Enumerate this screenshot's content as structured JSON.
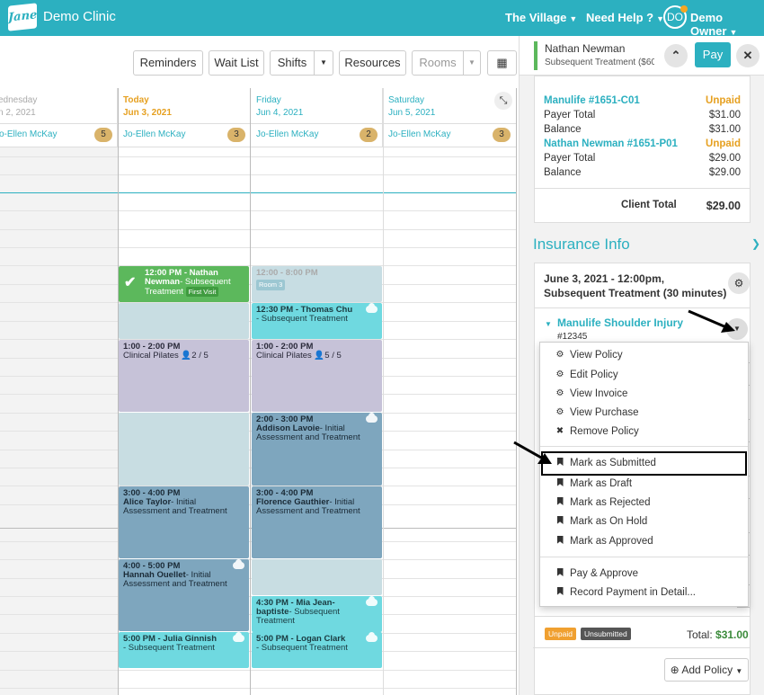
{
  "topbar": {
    "logo_text": "Jane",
    "clinic_name": "Demo Clinic",
    "location": "The Village",
    "help": "Need Help ?",
    "avatar_initials": "DO",
    "user": "Demo Owner"
  },
  "toolbar": {
    "reminders": "Reminders",
    "wait_list": "Wait List",
    "shifts": "Shifts",
    "resources": "Resources",
    "rooms": "Rooms"
  },
  "calendar": {
    "columns": [
      {
        "day": "ednesday",
        "date": "n 2, 2021",
        "staff": "o-Ellen McKay",
        "count": "5"
      },
      {
        "day": "Today",
        "date": "Jun 3, 2021",
        "staff": "Jo-Ellen McKay",
        "count": "3"
      },
      {
        "day": "Friday",
        "date": "Jun 4, 2021",
        "staff": "Jo-Ellen McKay",
        "count": "2"
      },
      {
        "day": "Saturday",
        "date": "Jun 5, 2021",
        "staff": "Jo-Ellen McKay",
        "count": "3"
      }
    ],
    "appointments": {
      "a1_time": "12:00 PM - Nathan",
      "a1_name": "Newman",
      "a1_desc": "- Subsequent",
      "a1_desc2": "Treatment",
      "a1_tag": "First Visit",
      "a2_time": "12:00 - 8:00 PM",
      "a2_room": "Room 3",
      "a3_time": "12:30 PM - Thomas Chu",
      "a3_desc": "- Subsequent Treatment",
      "a4_time": "1:00 - 2:00 PM",
      "a4_desc": "Clinical Pilates",
      "a4_count": "2 / 5",
      "a5_time": "1:00 - 2:00 PM",
      "a5_desc": "Clinical Pilates",
      "a5_count": "5 / 5",
      "a6_time": "2:00 - 3:00 PM",
      "a6_name": "Addison Lavoie",
      "a6_desc": "- Initial",
      "a6_desc2": "Assessment and Treatment",
      "a7_time": "3:00 - 4:00 PM",
      "a7_name": "Alice Taylor",
      "a7_desc": "- Initial",
      "a7_desc2": "Assessment and Treatment",
      "a8_time": "3:00 - 4:00 PM",
      "a8_name": "Florence Gauthier",
      "a8_desc": "- Initial",
      "a8_desc2": "Assessment and Treatment",
      "a9_time": "4:00 - 5:00 PM",
      "a9_name": "Hannah Ouellet",
      "a9_desc": "- Initial",
      "a9_desc2": "Assessment and Treatment",
      "a10_time": "4:30 PM - Mia Jean-",
      "a10_name": "baptiste",
      "a10_desc": "- Subsequent",
      "a10_desc2": "Treatment",
      "a11_time": "5:00 PM - Julia Ginnish",
      "a11_desc": "- Subsequent Treatment",
      "a12_time": "5:00 PM - Logan Clark",
      "a12_desc": "- Subsequent Treatment"
    }
  },
  "panel": {
    "patient_name": "Nathan Newman",
    "patient_sub": "Subsequent Treatment ($60",
    "pay": "Pay",
    "invoice": {
      "line1_name": "Manulife #1651-C01",
      "line1_status": "Unpaid",
      "payer_total_label": "Payer Total",
      "line1_payer_total": "$31.00",
      "balance_label": "Balance",
      "line1_balance": "$31.00",
      "line2_name": "Nathan Newman #1651-P01",
      "line2_status": "Unpaid",
      "line2_payer_total": "$29.00",
      "line2_balance": "$29.00",
      "client_total_label": "Client Total",
      "client_total": "$29.00"
    },
    "insurance_title": "Insurance Info",
    "appointment_line1": "June 3, 2021 - 12:00pm,",
    "appointment_line2": "Subsequent Treatment (30 minutes)",
    "policy_name": "Manulife Shoulder Injury",
    "policy_number": "#12345",
    "menu": [
      {
        "icon": "gear",
        "label": "View Policy"
      },
      {
        "icon": "gear",
        "label": "Edit Policy"
      },
      {
        "icon": "gear",
        "label": "View Invoice"
      },
      {
        "icon": "gear",
        "label": "View Purchase"
      },
      {
        "icon": "times",
        "label": "Remove Policy"
      },
      {
        "icon": "bookmark",
        "label": "Mark as Submitted"
      },
      {
        "icon": "bookmark",
        "label": "Mark as Draft"
      },
      {
        "icon": "bookmark",
        "label": "Mark as Rejected"
      },
      {
        "icon": "bookmark",
        "label": "Mark as On Hold"
      },
      {
        "icon": "bookmark",
        "label": "Mark as Approved"
      },
      {
        "icon": "bookmark",
        "label": "Pay & Approve"
      },
      {
        "icon": "bookmark",
        "label": "Record Payment in Detail..."
      }
    ],
    "status_unpaid": "Unpaid",
    "status_unsubmitted": "Unsubmitted",
    "total_label": "Total:",
    "total_value": "$31.00",
    "add_policy": "Add Policy"
  },
  "colors": {
    "brand": "#2cb0c0",
    "unpaid": "#e6a020",
    "green": "#5cb85c"
  }
}
